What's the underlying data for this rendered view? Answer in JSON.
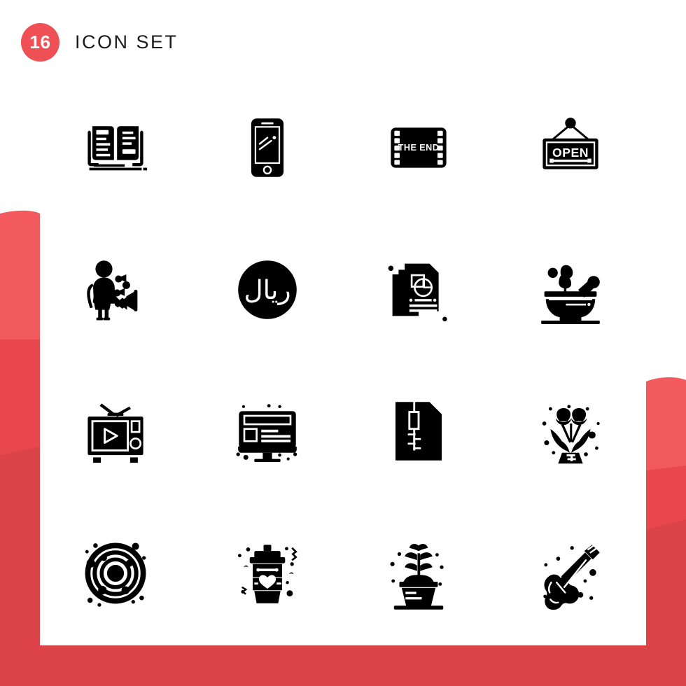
{
  "header": {
    "count": "16",
    "title": "ICON SET"
  },
  "theme": {
    "accent": "#ee5055",
    "accent_dark": "#dc4348",
    "accent_light": "#f25a5e",
    "icon_color": "#000000",
    "card_background": "#ffffff",
    "page_background": "#ffffff"
  },
  "icons": [
    {
      "name": "open-book-icon",
      "label": "Open book",
      "row": 1,
      "col": 1
    },
    {
      "name": "smartphone-icon",
      "label": "Smartphone",
      "row": 1,
      "col": 2
    },
    {
      "name": "film-strip-end-icon",
      "label": "Film strip THE END",
      "row": 1,
      "col": 3,
      "text": "THE END"
    },
    {
      "name": "open-sign-icon",
      "label": "Hanging open sign",
      "row": 1,
      "col": 4,
      "text": "OPEN"
    },
    {
      "name": "trumpet-player-icon",
      "label": "Person with trumpet",
      "row": 2,
      "col": 1
    },
    {
      "name": "riyal-coin-icon",
      "label": "Riyal currency coin",
      "row": 2,
      "col": 2,
      "text": "ريال"
    },
    {
      "name": "documents-report-icon",
      "label": "Stacked report documents",
      "row": 2,
      "col": 3
    },
    {
      "name": "mortar-pestle-icon",
      "label": "Mortar and pestle with herbs",
      "row": 2,
      "col": 4
    },
    {
      "name": "retro-television-icon",
      "label": "Retro TV with play button",
      "row": 3,
      "col": 1
    },
    {
      "name": "desktop-monitor-icon",
      "label": "Desktop monitor webpage",
      "row": 3,
      "col": 2
    },
    {
      "name": "zip-file-icon",
      "label": "Compressed zip file",
      "row": 3,
      "col": 3
    },
    {
      "name": "flower-bouquet-icon",
      "label": "Flower bouquet",
      "row": 3,
      "col": 4
    },
    {
      "name": "atom-orbit-icon",
      "label": "Atom orbit",
      "row": 4,
      "col": 1
    },
    {
      "name": "coffee-cup-heart-icon",
      "label": "Coffee cup with heart",
      "row": 4,
      "col": 2
    },
    {
      "name": "potted-plant-icon",
      "label": "Potted plant",
      "row": 4,
      "col": 3
    },
    {
      "name": "electric-guitar-icon",
      "label": "Electric guitar",
      "row": 4,
      "col": 4
    }
  ]
}
